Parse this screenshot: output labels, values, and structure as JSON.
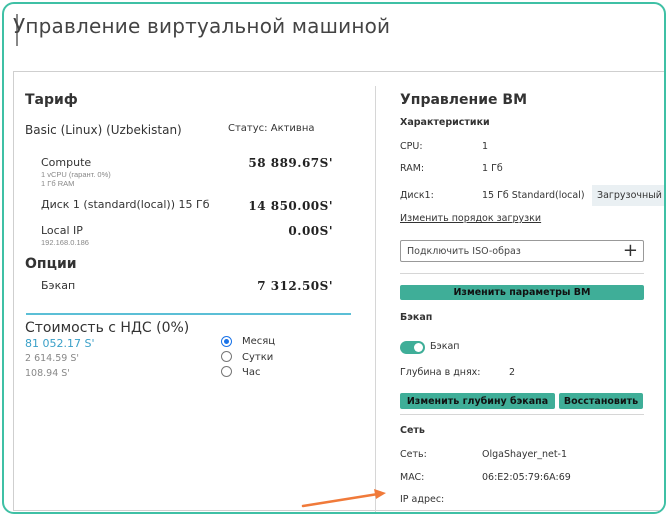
{
  "page": {
    "title": "Управление виртуальной машиной"
  },
  "tariff": {
    "heading": "Тариф",
    "plan": "Basic (Linux) (Uzbekistan)",
    "status": "Статус: Активна",
    "items": [
      {
        "name": "Compute",
        "details": [
          "1 vCPU (гарант. 0%)",
          "1 Гб RAM"
        ],
        "price": "58 889.67S'"
      },
      {
        "name": "Диск 1 (standard(local)) 15 Гб",
        "details": [],
        "price": "14 850.00S'"
      },
      {
        "name": "Local IP",
        "details": [
          "192.168.0.186"
        ],
        "price": "0.00S'"
      }
    ]
  },
  "options": {
    "heading": "Опции",
    "items": [
      {
        "name": "Бэкап",
        "price": "7 312.50S'"
      }
    ]
  },
  "vat": {
    "heading": "Стоимость с НДС (0%)",
    "values": [
      "81 052.17 S'",
      "2 614.59 S'",
      "108.94 S'"
    ],
    "periods": [
      {
        "label": "Месяц",
        "selected": true
      },
      {
        "label": "Сутки",
        "selected": false
      },
      {
        "label": "Час",
        "selected": false
      }
    ]
  },
  "vm": {
    "heading": "Управление ВМ",
    "specs_heading": "Характеристики",
    "cpu_label": "CPU:",
    "cpu_value": "1",
    "ram_label": "RAM:",
    "ram_value": "1 Гб",
    "disk_label": "Диск1:",
    "disk_value": "15 Гб Standard(local)",
    "disk_tag": "Загрузочный",
    "boot_order_link": "Изменить порядок загрузки",
    "iso_placeholder": "Подключить ISO-образ",
    "iso_plus": "+",
    "change_params_button": "Изменить параметры ВМ"
  },
  "backup": {
    "heading": "Бэкап",
    "toggle_label": "Бэкап",
    "toggle_on": true,
    "depth_label": "Глубина в днях:",
    "depth_value": "2",
    "change_depth_button": "Изменить глубину бэкапа",
    "restore_button": "Восстановить"
  },
  "network": {
    "heading": "Сеть",
    "net_label": "Сеть:",
    "net_value": "OlgaShayer_net-1",
    "mac_label": "MAC:",
    "mac_value": "06:E2:05:79:6A:69",
    "ip_label": "IP адрес:"
  },
  "colors": {
    "accent": "#3fae98",
    "frame": "#3fc0a5",
    "link_blue": "#3aa0c8",
    "arrow": "#f07a3a"
  }
}
